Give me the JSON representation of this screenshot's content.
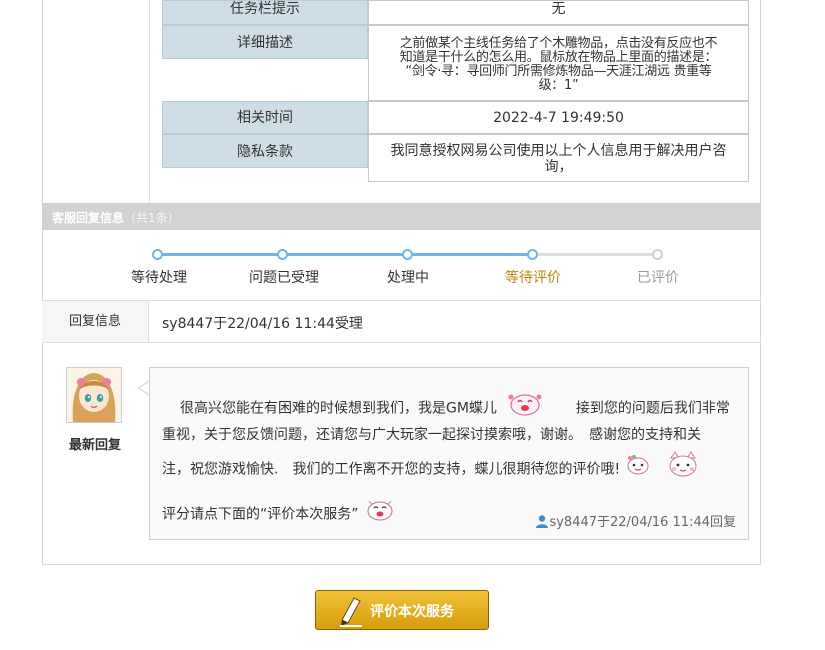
{
  "ticket_rows": [
    {
      "label": "任务栏提示",
      "value": "无"
    },
    {
      "label": "详细描述",
      "value_lines": [
        "之前做某个主线任务给了个木雕物品，点击没有反应也不",
        "知道是干什么的怎么用。鼠标放在物品上里面的描述是：",
        "“剑令·寻：寻回师门所需修炼物品—天涯江湖远 贵重等",
        "级：1”"
      ]
    },
    {
      "label": "相关时间",
      "value": "2022-4-7 19:49:50"
    },
    {
      "label": "隐私条款",
      "value_lines": [
        "我同意授权网易公司使用以上个人信息用于解决用户咨",
        "询，"
      ]
    }
  ],
  "reply_section": {
    "title": "客服回复信息",
    "count": "（共1条）"
  },
  "progress": {
    "steps": [
      {
        "label": "等待处理",
        "state": "done"
      },
      {
        "label": "问题已受理",
        "state": "done"
      },
      {
        "label": "处理中",
        "state": "done"
      },
      {
        "label": "等待评价",
        "state": "current"
      },
      {
        "label": "已评价",
        "state": "pending"
      }
    ],
    "colors": {
      "done": "#333333",
      "current": "#b8860b",
      "pending": "#999999",
      "track_on": "#6cb7e8",
      "track_off": "#dddddd"
    }
  },
  "reply_info": {
    "label": "回复信息",
    "value": "sy8447于22/04/16 11:44受理"
  },
  "reply": {
    "latest_label": "最新回复",
    "line1_a": "很高兴您能在有困难的时候想到我们，我是GM蝶儿",
    "line1_b": "接到您的问题后我们非常",
    "line2": "重视，关于您反馈问题，还请您与广大玩家一起探讨摸索哦，谢谢。　感谢您的支持和关",
    "line3": "注，祝您游戏愉快.　我们的工作离不开您的支持，蝶儿很期待您的评价哦!",
    "line4": "评分请点下面的“评价本次服务”",
    "footer": "sy8447于22/04/16 11:44回复"
  },
  "rate_button": {
    "label": "评价本次服务",
    "color": "#e0aa1c"
  }
}
